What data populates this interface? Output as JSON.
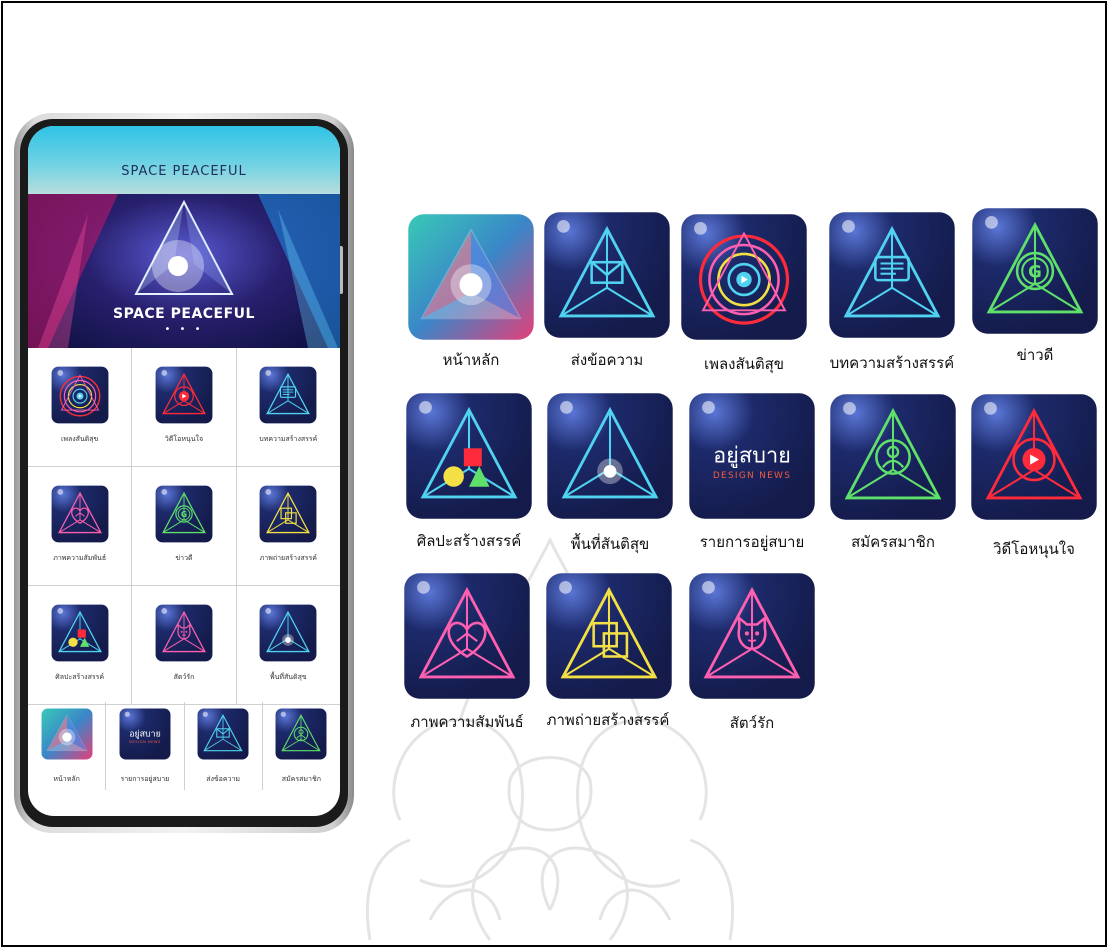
{
  "app": {
    "title": "SPACE PEACEFUL",
    "banner_title": "SPACE PEACEFUL",
    "banner_dots": "• • •"
  },
  "phone_grid": [
    {
      "label": "เพลงสันติสุข",
      "icon": "music-circle-icon"
    },
    {
      "label": "วิดีโอหนุนใจ",
      "icon": "video-play-icon"
    },
    {
      "label": "บทความสร้างสรรค์",
      "icon": "article-icon"
    },
    {
      "label": "ภาพความสัมพันธ์",
      "icon": "heart-hands-icon"
    },
    {
      "label": "ข่าวดี",
      "icon": "g-circle-icon"
    },
    {
      "label": "ภาพถ่ายสร้างสรรค์",
      "icon": "photo-frame-icon"
    },
    {
      "label": "ศิลปะสร้างสรรค์",
      "icon": "shapes-art-icon"
    },
    {
      "label": "สัตว์รัก",
      "icon": "cat-icon"
    },
    {
      "label": "พื้นที่สันติสุข",
      "icon": "light-pyramid-icon"
    }
  ],
  "phone_bottom": [
    {
      "label": "หน้าหลัก",
      "icon": "home-pyramid-icon"
    },
    {
      "label": "รายการอยู่สบาย",
      "icon": "yusabai-logo-icon"
    },
    {
      "label": "ส่งข้อความ",
      "icon": "envelope-icon"
    },
    {
      "label": "สมัครสมาชิก",
      "icon": "member-icon"
    }
  ],
  "gallery": [
    {
      "label": "หน้าหลัก",
      "icon": "home-pyramid-icon"
    },
    {
      "label": "ส่งข้อความ",
      "icon": "envelope-icon"
    },
    {
      "label": "เพลงสันติสุข",
      "icon": "music-circle-icon"
    },
    {
      "label": "บทความสร้างสรรค์",
      "icon": "article-icon"
    },
    {
      "label": "ข่าวดี",
      "icon": "g-circle-icon"
    },
    {
      "label": "ศิลปะสร้างสรรค์",
      "icon": "shapes-art-icon"
    },
    {
      "label": "พื้นที่สันติสุข",
      "icon": "light-pyramid-icon"
    },
    {
      "label": "รายการอยู่สบาย",
      "icon": "yusabai-logo-icon"
    },
    {
      "label": "สมัครสมาชิก",
      "icon": "member-icon"
    },
    {
      "label": "วิดีโอหนุนใจ",
      "icon": "video-play-icon"
    },
    {
      "label": "ภาพความสัมพันธ์",
      "icon": "heart-hands-icon"
    },
    {
      "label": "ภาพถ่ายสร้างสรรค์",
      "icon": "photo-frame-icon"
    },
    {
      "label": "สัตว์รัก",
      "icon": "cat-icon"
    }
  ],
  "logo_text": {
    "main": "อยู่สบาย",
    "sub": "DESIGN NEWS"
  },
  "colors": {
    "tile_bg": "#1d2a6b",
    "cyan": "#4fd3f0",
    "pink": "#ff5fb0",
    "green": "#5ee06a",
    "yellow": "#f3e045",
    "red": "#ff2b3a",
    "header": "#45c9e3"
  }
}
